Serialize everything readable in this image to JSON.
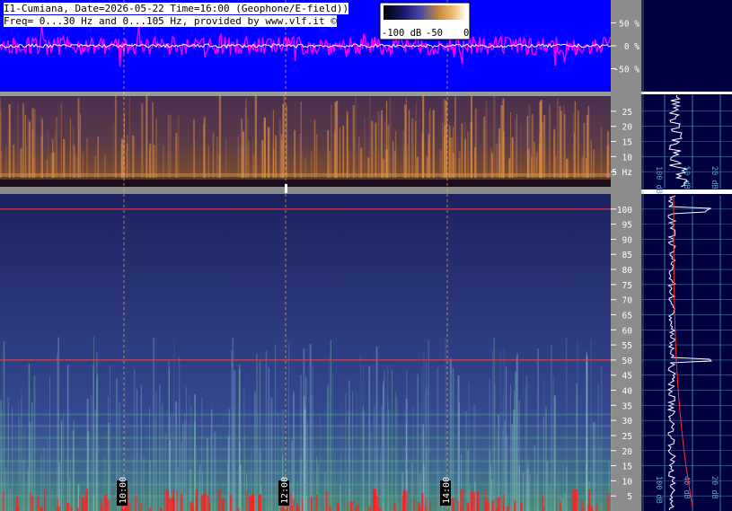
{
  "header": {
    "line1": "I1-Cumiana, Date=2026-05-22 Time=16:00 (Geophone/E-field))",
    "line2": "Freq= 0...30 Hz and 0...105 Hz, provided by www.vlf.it ©"
  },
  "colorbar": {
    "labels": [
      "-100 dB",
      "-50",
      "0"
    ]
  },
  "colors": {
    "background_blue": "#0000ff",
    "amplitude_trace": "#ff00ff",
    "amplitude_core": "#ffffff",
    "low_spec_bg": "#3a2a4a",
    "low_spec_glow": "#e09040",
    "high_spec_bg": "#2a3570",
    "hum_line": "#ff4040",
    "side_panel": "#000040",
    "grid_line": "#5aa8c8",
    "time_marker": "#f0c080"
  },
  "chart_data": [
    {
      "type": "line",
      "title": "",
      "ylabel": "",
      "y_axis_ticks": [
        "50 %",
        "0 %",
        "-50 %"
      ],
      "note_ylim_percent": [
        -100,
        100
      ]
    },
    {
      "type": "heatmap",
      "ylabel": "Hz",
      "y_axis_ticks": [
        "25",
        "20",
        "15",
        "10",
        "5 Hz"
      ],
      "ylim": [
        0,
        30
      ]
    },
    {
      "type": "heatmap",
      "ylabel": "Hz",
      "y_axis_ticks": [
        "100",
        "95",
        "90",
        "85",
        "80",
        "75",
        "70",
        "65",
        "60",
        "55",
        "50",
        "45",
        "40",
        "35",
        "30",
        "25",
        "20",
        "15",
        "10",
        "5"
      ],
      "ylim": [
        0,
        105
      ],
      "notable_lines_hz": [
        50,
        100
      ],
      "time_ticks": [
        "10:00",
        "12:00",
        "14:00"
      ]
    },
    {
      "type": "line",
      "title": "",
      "side_profile_ticks_upper": [
        "100 dB",
        "50 dB",
        "20 dB"
      ],
      "side_profile_ticks_lower": [
        "100 dB",
        "40 dB",
        "20 dB"
      ]
    }
  ]
}
